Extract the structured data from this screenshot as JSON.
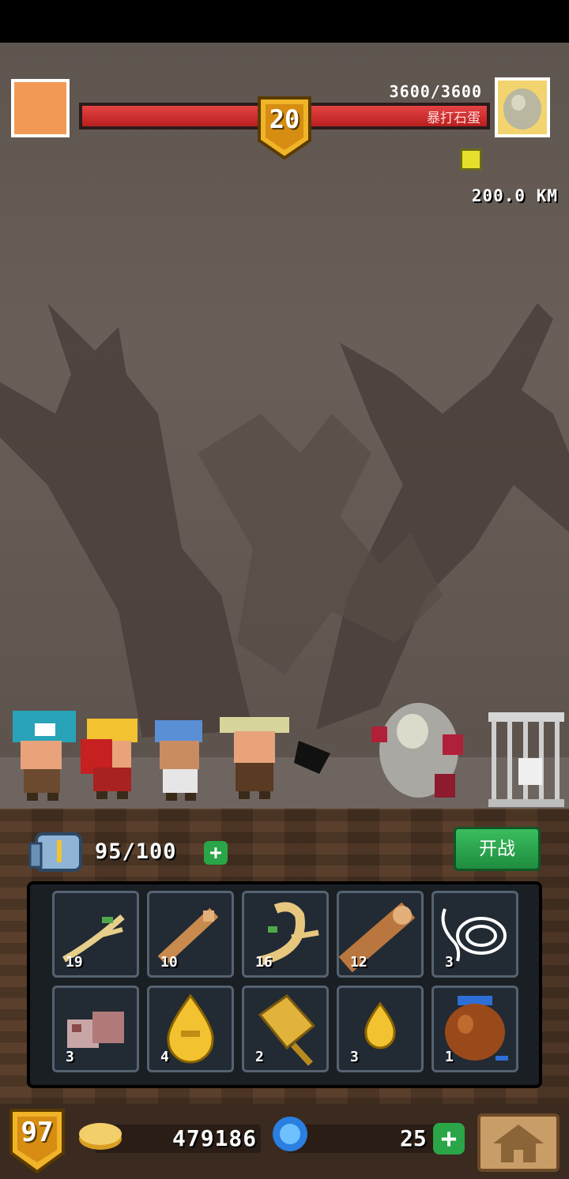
{
  "hud": {
    "boss_level": "20",
    "hp": "3600/3600",
    "enemy_name": "暴打石蛋",
    "distance": "200.0 KM"
  },
  "stamina": {
    "value": "95/100",
    "plus": "+"
  },
  "battle_button": {
    "label": "开战"
  },
  "inventory": {
    "items": [
      {
        "icon": "branch-icon",
        "count": "19"
      },
      {
        "icon": "wood-stick-icon",
        "count": "10"
      },
      {
        "icon": "root-icon",
        "count": "16"
      },
      {
        "icon": "log-icon",
        "count": "12"
      },
      {
        "icon": "rope-icon",
        "count": "3"
      },
      {
        "icon": "stone-ore-icon",
        "count": "3"
      },
      {
        "icon": "golden-drop-icon",
        "count": "4"
      },
      {
        "icon": "golden-shovel-icon",
        "count": "2"
      },
      {
        "icon": "small-golden-drop-icon",
        "count": "3"
      },
      {
        "icon": "pot-icon",
        "count": "1"
      }
    ]
  },
  "footer": {
    "player_level": "97",
    "gold": "479186",
    "gems": "25",
    "gem_plus": "+"
  },
  "colors": {
    "hp_red": "#d32a2a",
    "accent_green": "#2aa547",
    "gold": "#f2c230"
  }
}
